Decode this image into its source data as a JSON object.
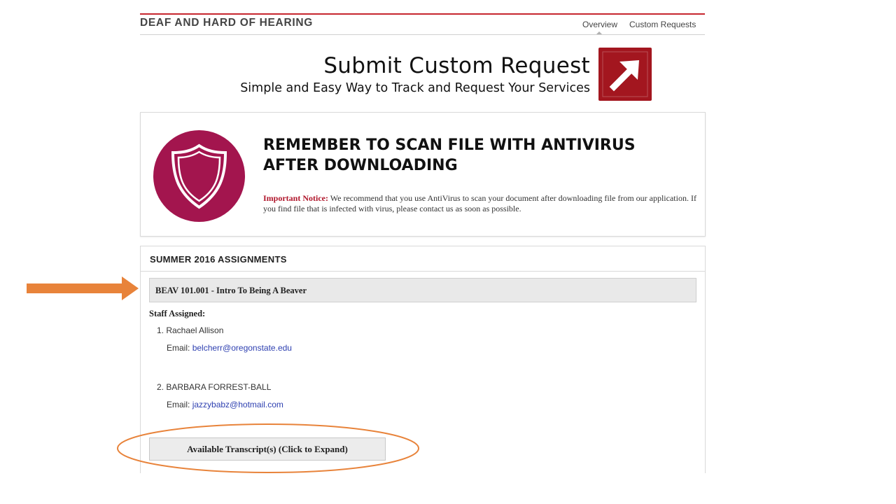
{
  "header": {
    "title": "DEAF AND HARD OF HEARING",
    "nav": [
      {
        "label": "Overview"
      },
      {
        "label": "Custom Requests"
      }
    ]
  },
  "banner": {
    "title": "Submit Custom Request",
    "subtitle": "Simple and Easy Way to Track and Request Your Services",
    "icon": "arrow-up-right-icon",
    "brand_color": "#a3161f"
  },
  "notice": {
    "heading_line1": "REMEMBER TO SCAN FILE WITH ANTIVIRUS",
    "heading_line2": "AFTER DOWNLOADING",
    "label": "Important Notice:",
    "text": "We recommend that you use AntiVirus to scan your document after downloading file from our application. If you find file that is infected with virus, please contact us as soon as possible.",
    "icon": "shield-icon",
    "icon_color": "#a3154e"
  },
  "assignments": {
    "title": "SUMMER 2016 ASSIGNMENTS",
    "course": "BEAV 101.001 - Intro To Being A Beaver",
    "staff_label": "Staff Assigned:",
    "email_label": "Email:",
    "staff": [
      {
        "name": "1. Rachael Allison",
        "email": "belcherr@oregonstate.edu"
      },
      {
        "name": "2. BARBARA FORREST-BALL",
        "email": "jazzybabz@hotmail.com"
      }
    ],
    "transcript_button": "Available Transcript(s) (Click to Expand)"
  },
  "annotation_color": "#e8833a"
}
